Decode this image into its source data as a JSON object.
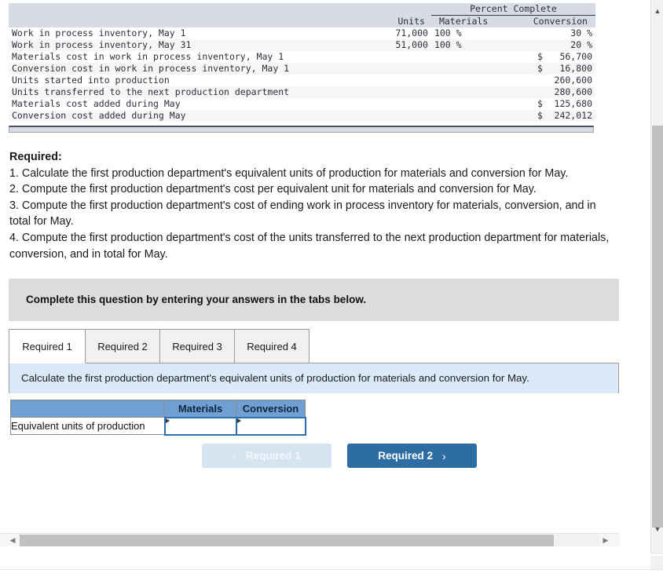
{
  "data_table": {
    "header_group": "Percent Complete",
    "columns": [
      "",
      "Units",
      "Materials",
      "Conversion"
    ],
    "rows": [
      {
        "label": "Work in process inventory, May 1",
        "units": "71,000",
        "materials": "100 %",
        "conversion": "30 %",
        "type": "units"
      },
      {
        "label": "Work in process inventory, May 31",
        "units": "51,000",
        "materials": "100 %",
        "conversion": "20 %",
        "type": "units"
      },
      {
        "label": "Materials cost in work in process inventory, May 1",
        "dollar": "$",
        "amount": "56,700",
        "type": "money"
      },
      {
        "label": "Conversion cost in work in process inventory, May 1",
        "dollar": "$",
        "amount": "16,800",
        "type": "money"
      },
      {
        "label": "Units started into production",
        "dollar": "",
        "amount": "260,600",
        "type": "money"
      },
      {
        "label": "Units transferred to the next production department",
        "dollar": "",
        "amount": "280,600",
        "type": "money"
      },
      {
        "label": "Materials cost added during May",
        "dollar": "$",
        "amount": "125,680",
        "type": "money"
      },
      {
        "label": "Conversion cost added during May",
        "dollar": "$",
        "amount": "242,012",
        "type": "money"
      }
    ]
  },
  "required": {
    "title": "Required:",
    "items": [
      "1. Calculate the first production department's equivalent units of production for materials and conversion for May.",
      "2. Compute the first production department's cost per equivalent unit for materials and conversion for May.",
      "3. Compute the first production department's cost of ending work in process inventory for materials, conversion, and in total for May.",
      "4. Compute the first production department's cost of the units transferred to the next production department for materials, conversion, and in total for May."
    ]
  },
  "gray_banner": {
    "text": "Complete this question by entering your answers in the tabs below."
  },
  "tabs": {
    "items": [
      {
        "label": "Required 1",
        "active": true
      },
      {
        "label": "Required 2",
        "active": false
      },
      {
        "label": "Required 3",
        "active": false
      },
      {
        "label": "Required 4",
        "active": false
      }
    ]
  },
  "blue_strip": {
    "text": "Calculate the first production department's equivalent units of production for materials and conversion for May."
  },
  "answer_grid": {
    "corner_label": "",
    "columns": [
      "Materials",
      "Conversion"
    ],
    "row_label": "Equivalent units of production",
    "materials_value": "",
    "conversion_value": "",
    "placeholder": ""
  },
  "navigation": {
    "prev_label": "Required 1",
    "prev_icon": "chevron-left",
    "prev_glyph": "‹",
    "next_label": "Required 2",
    "next_icon": "chevron-right",
    "next_glyph": "›"
  },
  "scrollbars": {
    "up_glyph": "▲",
    "down_glyph": "▼",
    "left_glyph": "◀",
    "right_glyph": "▶"
  },
  "colors": {
    "table_header_bg": "#d6dbe6",
    "answer_header_bg": "#6f9fd3",
    "input_border": "#2e6fad",
    "blue_strip_bg": "#dbeaf8",
    "gray_banner_bg": "#dcdcdc",
    "next_button_bg": "#2d6da4",
    "prev_button_bg": "#d6e4f2"
  }
}
